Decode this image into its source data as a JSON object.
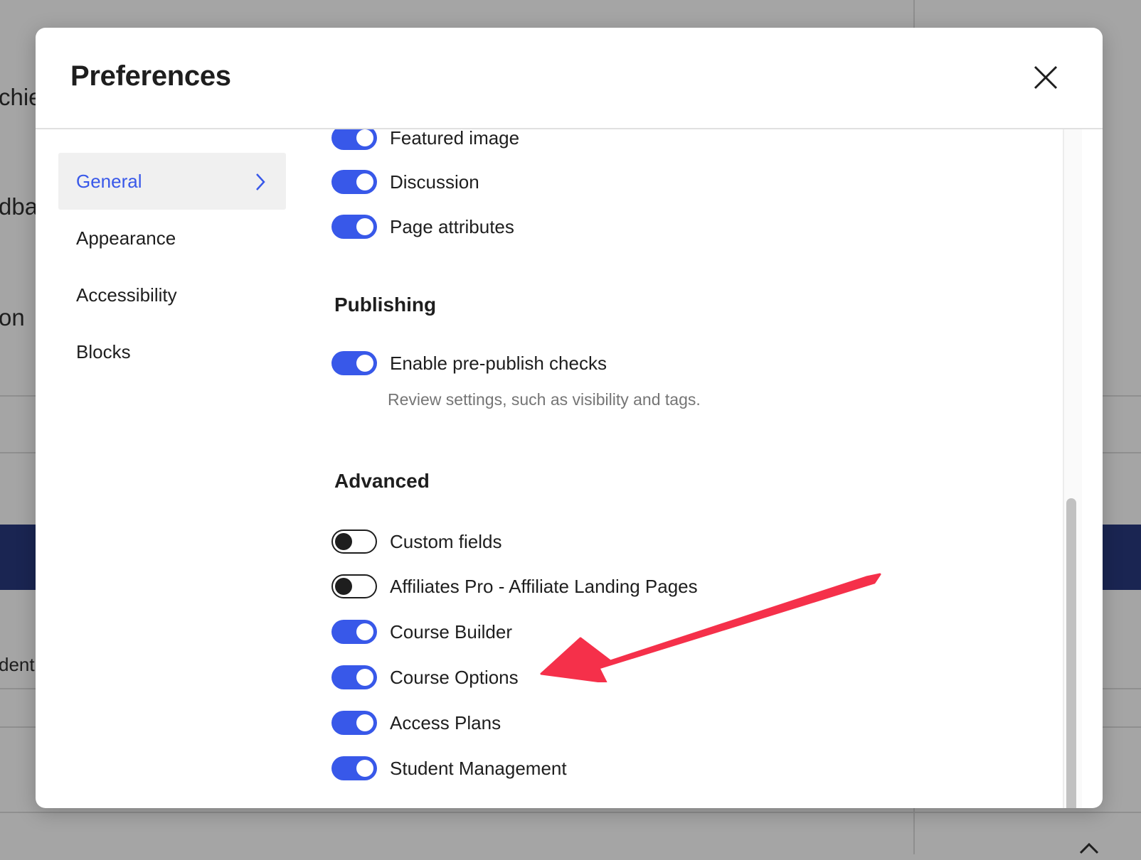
{
  "background": {
    "fragments": [
      "chie",
      "dba",
      "on",
      "dent"
    ],
    "dark_band_color": "#1a2552"
  },
  "modal": {
    "title": "Preferences",
    "close_icon": "close-icon"
  },
  "sidebar": {
    "items": [
      {
        "label": "General",
        "active": true
      },
      {
        "label": "Appearance",
        "active": false
      },
      {
        "label": "Accessibility",
        "active": false
      },
      {
        "label": "Blocks",
        "active": false
      }
    ]
  },
  "panels": {
    "featured_image": {
      "label": "Featured image",
      "on": true
    },
    "discussion": {
      "label": "Discussion",
      "on": true
    },
    "page_attributes": {
      "label": "Page attributes",
      "on": true
    }
  },
  "publishing": {
    "title": "Publishing",
    "prepublish": {
      "label": "Enable pre-publish checks",
      "help": "Review settings, such as visibility and tags.",
      "on": true
    }
  },
  "advanced": {
    "title": "Advanced",
    "items": [
      {
        "label": "Custom fields",
        "on": false
      },
      {
        "label": "Affiliates Pro - Affiliate Landing Pages",
        "on": false
      },
      {
        "label": "Course Builder",
        "on": true
      },
      {
        "label": "Course Options",
        "on": true
      },
      {
        "label": "Access Plans",
        "on": true
      },
      {
        "label": "Student Management",
        "on": true
      }
    ]
  },
  "colors": {
    "accent": "#3858e9",
    "annotation_arrow": "#f5304a"
  }
}
